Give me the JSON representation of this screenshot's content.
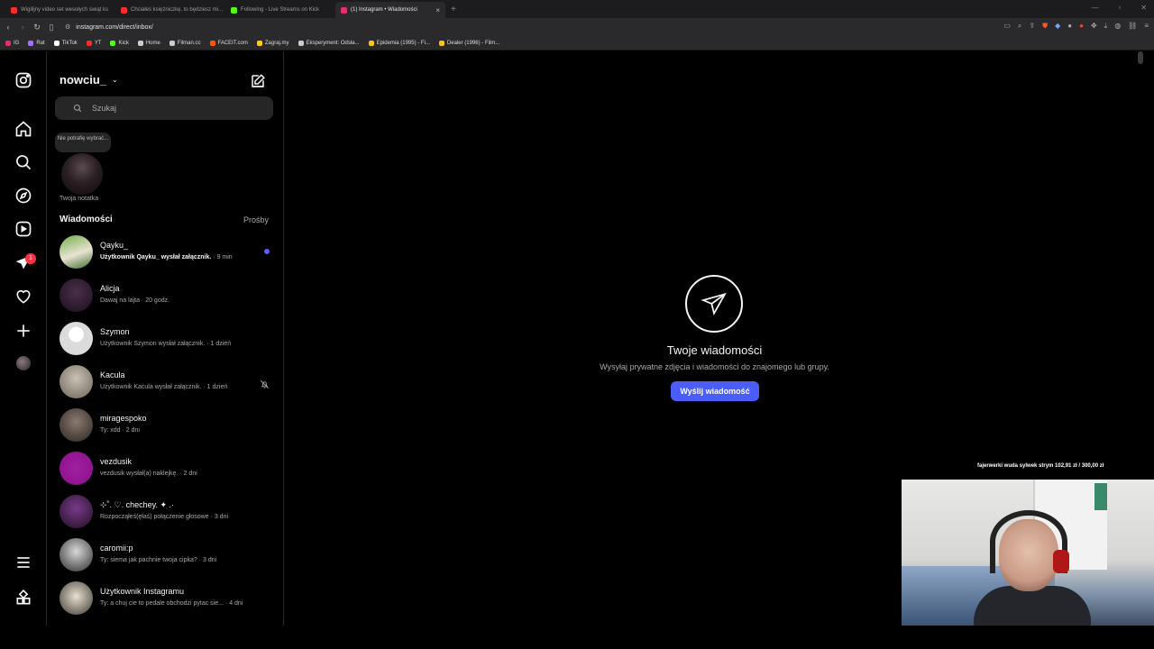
{
  "browser": {
    "tabs": [
      {
        "label": "Wigilijny video set wesołych świąt ks",
        "color": "#ff2b2b",
        "active": false
      },
      {
        "label": "Chciałeś księżniczkę, to będziesz mi...",
        "color": "#ff2b2b",
        "active": false
      },
      {
        "label": "Following - Live Streams on Kick",
        "color": "#53fc18",
        "active": false
      },
      {
        "label": "(1) Instagram • Wiadomości",
        "color": "#e1306c",
        "active": true
      }
    ],
    "new_tab_symbol": "+",
    "url": "instagram.com/direct/inbox/",
    "bookmarks": [
      {
        "label": "IG",
        "color": "#e1306c"
      },
      {
        "label": "Rat",
        "color": "#a070ff"
      },
      {
        "label": "TikTok",
        "color": "#ffffff"
      },
      {
        "label": "YT",
        "color": "#ff2b2b"
      },
      {
        "label": "Kick",
        "color": "#53fc18"
      },
      {
        "label": "Home",
        "color": "#cccccc"
      },
      {
        "label": "Filman.cc",
        "color": "#cccccc"
      },
      {
        "label": "FACEIT.com",
        "color": "#ff5500"
      },
      {
        "label": "Zagraj.my",
        "color": "#ffcc00"
      },
      {
        "label": "Eksperyment: Odsła...",
        "color": "#cccccc"
      },
      {
        "label": "Epidemia (1995) - Fi...",
        "color": "#f5c518"
      },
      {
        "label": "Dealer (1996) - Film...",
        "color": "#f5c518"
      }
    ]
  },
  "rail": {
    "badge_count": "1"
  },
  "inbox": {
    "username": "nowciu_",
    "search_placeholder": "Szukaj",
    "note_text": "Nie potrafię wybrać...",
    "note_label": "Twoja notatka",
    "section_title": "Wiadomości",
    "requests_label": "Prośby",
    "conversations": [
      {
        "name": "Qayku_",
        "preview": "Użytkownik Qayku_ wysłał załącznik.",
        "time": " · 9 min",
        "unread": true,
        "muted": false,
        "avatar": "linear-gradient(160deg,#6fae4a,#e9e3d2 55%,#3b6b2a)"
      },
      {
        "name": "Alicja",
        "preview": "Dawaj na lajta",
        "time": " · 20 godz.",
        "unread": false,
        "muted": false,
        "avatar": "radial-gradient(circle at 50% 40%,#4a2f4a,#1a0f1c)"
      },
      {
        "name": "Szymon",
        "preview": "Użytkownik Szymon wysłał załącznik.",
        "time": " · 1 dzień",
        "unread": false,
        "muted": false,
        "avatar": "radial-gradient(circle at 50% 38%,#ffffff 0 28%,#dbdbdb 29%)"
      },
      {
        "name": "Kacula",
        "preview": "Użytkownik Kacula wysłał załącznik.",
        "time": " · 1 dzień",
        "unread": false,
        "muted": true,
        "avatar": "radial-gradient(circle at 50% 40%,#c9c2b6,#6d6356)"
      },
      {
        "name": "miragespoko",
        "preview": "Ty: xdd",
        "time": " · 2 dni",
        "unread": false,
        "muted": false,
        "avatar": "radial-gradient(circle at 50% 40%,#8a7a70,#2a2420)"
      },
      {
        "name": "vezdusik",
        "preview": "vezdusik wysłał(a) naklejkę.",
        "time": " · 2 dni",
        "unread": false,
        "muted": false,
        "avatar": "radial-gradient(circle,#a020a0,#8a0f8a)"
      },
      {
        "name": "⊹˚. ♡. chechey. ✦ .·",
        "preview": "Rozpocząłeś(ęłaś) połączenie głosowe",
        "time": " · 3 dni",
        "unread": false,
        "muted": false,
        "avatar": "radial-gradient(circle at 50% 40%,#7a3a8a,#201022)"
      },
      {
        "name": "caromii:p",
        "preview": "Ty: siema jak pachnie twoja cipka?",
        "time": " · 3 dni",
        "unread": false,
        "muted": false,
        "avatar": "radial-gradient(circle at 50% 40%,#d8d8d8,#2a2a2a)"
      },
      {
        "name": "Użytkownik Instagramu",
        "preview": "Ty: a chuj cie to pedale obchodzi pytac sie...",
        "time": " · 4 dni",
        "unread": false,
        "muted": false,
        "avatar": "radial-gradient(circle at 50% 45%,#e8e0d0,#3a3630)"
      }
    ]
  },
  "empty_state": {
    "title": "Twoje wiadomości",
    "subtitle": "Wysyłaj prywatne zdjęcia i wiadomości do znajomego lub grupy.",
    "button_label": "Wyślij wiadomość"
  },
  "overlay": {
    "donation_text": "fajerwerki wuda sylwek strym  102,91 zł  /  300,00 zł"
  },
  "colors": {
    "accent": "#4a5df9",
    "unread_dot": "#5c5cff",
    "badge": "#ff3040"
  }
}
